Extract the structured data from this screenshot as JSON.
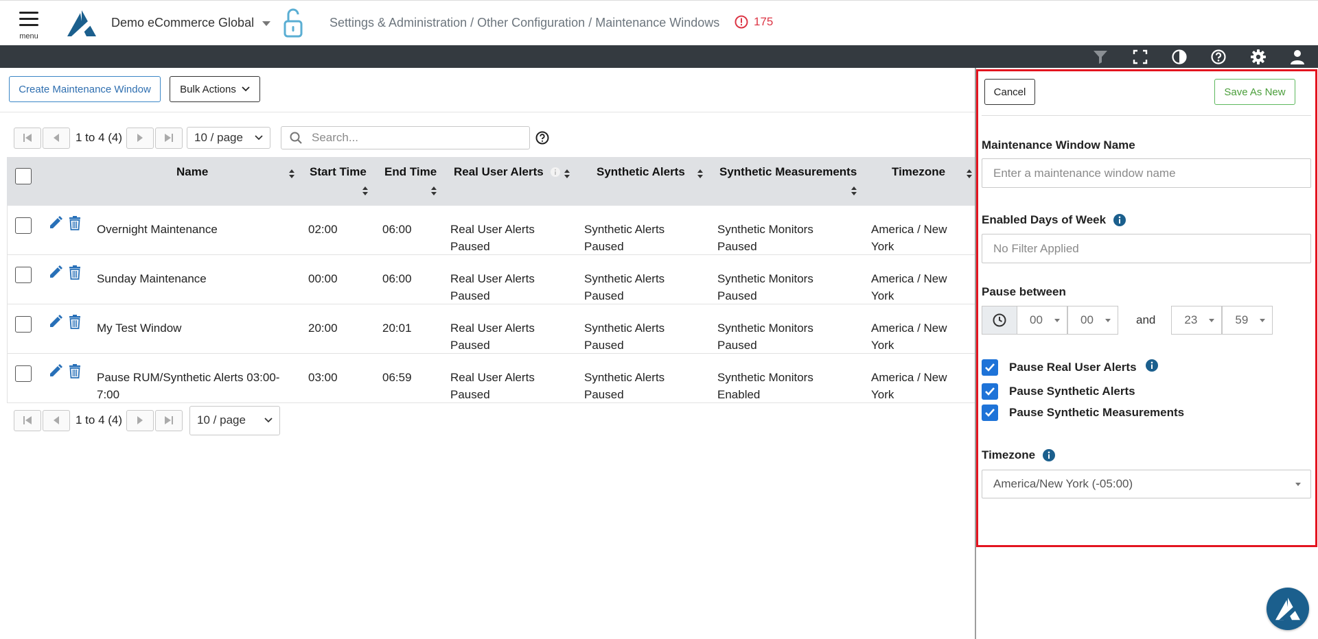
{
  "header": {
    "menu_label": "menu",
    "org_name": "Demo eCommerce Global",
    "breadcrumb": "Settings & Administration / Other Configuration / Maintenance Windows",
    "alert_count": "175"
  },
  "toolbar": {
    "icons": [
      "filter-icon",
      "fullscreen-icon",
      "contrast-icon",
      "help-icon",
      "gear-icon",
      "user-icon"
    ]
  },
  "actions": {
    "create_label": "Create Maintenance Window",
    "bulk_label": "Bulk Actions"
  },
  "pagination": {
    "range": "1 to 4 (4)",
    "page_size": "10 / page"
  },
  "search": {
    "placeholder": "Search..."
  },
  "table": {
    "columns": {
      "name": "Name",
      "start": "Start Time",
      "end": "End Time",
      "rum": "Real User Alerts",
      "synthetic": "Synthetic Alerts",
      "measurements": "Synthetic Measurements",
      "timezone": "Timezone"
    },
    "rows": [
      {
        "name": "Overnight Maintenance",
        "start": "02:00",
        "end": "06:00",
        "rum": [
          "Real User Alerts",
          "Paused"
        ],
        "synthetic": [
          "Synthetic Alerts",
          "Paused"
        ],
        "measurements": [
          "Synthetic Monitors",
          "Paused"
        ],
        "timezone": [
          "America / New",
          "York"
        ]
      },
      {
        "name": "Sunday Maintenance",
        "start": "00:00",
        "end": "06:00",
        "rum": [
          "Real User Alerts",
          "Paused"
        ],
        "synthetic": [
          "Synthetic Alerts",
          "Paused"
        ],
        "measurements": [
          "Synthetic Monitors",
          "Paused"
        ],
        "timezone": [
          "America / New",
          "York"
        ]
      },
      {
        "name": "My Test Window",
        "start": "20:00",
        "end": "20:01",
        "rum": [
          "Real User Alerts",
          "Paused"
        ],
        "synthetic": [
          "Synthetic Alerts",
          "Paused"
        ],
        "measurements": [
          "Synthetic Monitors",
          "Paused"
        ],
        "timezone": [
          "America / New",
          "York"
        ]
      },
      {
        "name": [
          "Pause RUM/Synthetic Alerts 03:00-",
          "7:00"
        ],
        "start": "03:00",
        "end": "06:59",
        "rum": [
          "Real User Alerts",
          "Paused"
        ],
        "synthetic": [
          "Synthetic Alerts",
          "Paused"
        ],
        "measurements": [
          "Synthetic Monitors",
          "Enabled"
        ],
        "timezone": [
          "America / New",
          "York"
        ]
      }
    ]
  },
  "panel": {
    "cancel_label": "Cancel",
    "save_label": "Save As New",
    "name_label": "Maintenance Window Name",
    "name_placeholder": "Enter a maintenance window name",
    "days_label": "Enabled Days of Week",
    "days_value": "No Filter Applied",
    "pause_label": "Pause between",
    "start_hour": "00",
    "start_minute": "00",
    "and_label": "and",
    "end_hour": "23",
    "end_minute": "59",
    "chk_rum": "Pause Real User Alerts",
    "chk_synthetic": "Pause Synthetic Alerts",
    "chk_measurements": "Pause Synthetic Measurements",
    "timezone_label": "Timezone",
    "timezone_value": "America/New York (-05:00)"
  },
  "colors": {
    "paused": "#c9b62e",
    "enabled": "#45a63a",
    "accent": "#2f6fb0",
    "alert": "#dc3545",
    "highlight": "#e3141f"
  }
}
